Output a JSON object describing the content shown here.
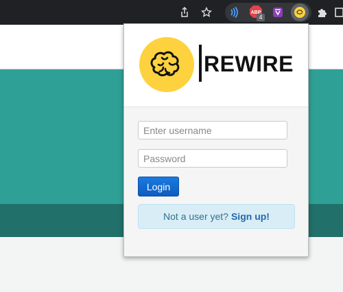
{
  "toolbar": {
    "icons": [
      "share-icon",
      "star-icon",
      "sound-extension-icon",
      "adblock-icon",
      "vault-extension-icon",
      "rewire-extension-icon",
      "puzzle-icon",
      "sidebar-icon"
    ],
    "adblock_badge_text": "ABP",
    "adblock_count": "4"
  },
  "popup": {
    "logo_text": "REWIRE",
    "username_placeholder": "Enter username",
    "password_placeholder": "Password",
    "login_label": "Login",
    "signup_prompt": "Not a user yet?",
    "signup_link": "Sign up!"
  },
  "colors": {
    "toolbar_bg": "#202124",
    "teal": "#2fa096",
    "teal_dark": "#22706a",
    "logo_yellow": "#fdd23e",
    "login_blue": "#1565c8",
    "signup_bg": "#d9edf7"
  }
}
